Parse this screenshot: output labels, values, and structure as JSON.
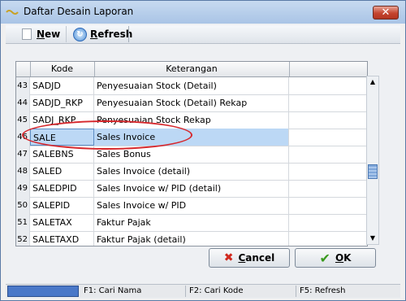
{
  "window": {
    "title": "Daftar Desain Laporan",
    "close_glyph": "✕"
  },
  "toolbar": {
    "new_label": "New",
    "new_key": "N",
    "new_rest": "ew",
    "refresh_label": "Refresh",
    "refresh_key": "R",
    "refresh_rest": "efresh"
  },
  "grid": {
    "columns": [
      "Kode",
      "Keterangan"
    ],
    "rows": [
      {
        "num": "43",
        "kode": "SADJD",
        "ket": "Penyesuaian Stock (Detail)"
      },
      {
        "num": "44",
        "kode": "SADJD_RKP",
        "ket": "Penyesuaian Stock (Detail) Rekap"
      },
      {
        "num": "45",
        "kode": "SADJ_RKP",
        "ket": "Penyesuaian Stock Rekap"
      },
      {
        "num": "46",
        "kode": "SALE",
        "ket": "Sales Invoice",
        "selected": true
      },
      {
        "num": "47",
        "kode": "SALEBNS",
        "ket": "Sales Bonus"
      },
      {
        "num": "48",
        "kode": "SALED",
        "ket": "Sales Invoice (detail)"
      },
      {
        "num": "49",
        "kode": "SALEDPID",
        "ket": "Sales Invoice w/ PID (detail)"
      },
      {
        "num": "50",
        "kode": "SALEPID",
        "ket": "Sales Invoice w/ PID"
      },
      {
        "num": "51",
        "kode": "SALETAX",
        "ket": "Faktur Pajak"
      },
      {
        "num": "52",
        "kode": "SALETAXD",
        "ket": "Faktur Pajak (detail)"
      }
    ]
  },
  "buttons": {
    "cancel_key": "C",
    "cancel_rest": "ancel",
    "ok_key": "O",
    "ok_rest": "K"
  },
  "statusbar": {
    "f1": "F1: Cari Nama",
    "f2": "F2: Cari Kode",
    "f5": "F5: Refresh"
  },
  "colors": {
    "selection": "#bcd8f5",
    "highlight": "#d6272c"
  }
}
